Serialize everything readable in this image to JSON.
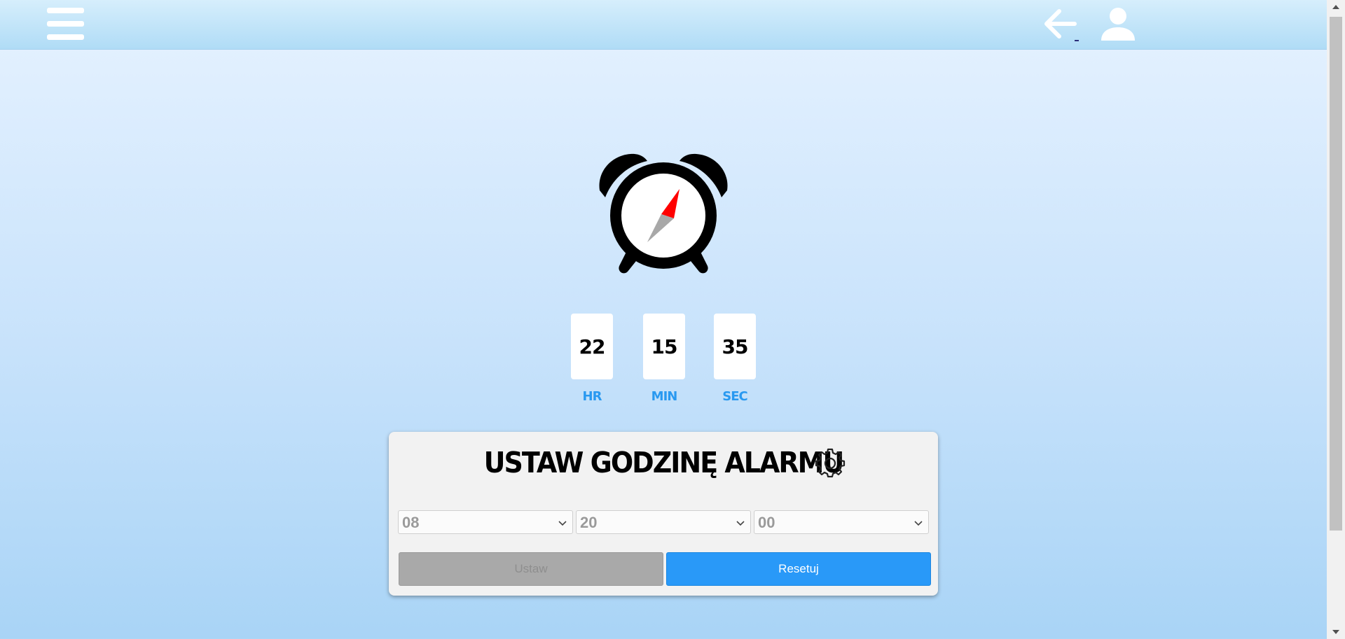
{
  "header": {
    "menu_icon": "hamburger-menu-icon",
    "back_icon": "arrow-left-icon",
    "user_icon": "user-icon"
  },
  "clock": {
    "icon": "alarm-clock-icon",
    "hours": "22",
    "minutes": "15",
    "seconds": "35",
    "hours_label": "HR",
    "minutes_label": "MIN",
    "seconds_label": "SEC"
  },
  "alarm_panel": {
    "title": "USTAW GODZINĘ ALARMU",
    "settings_icon": "gear-icon",
    "hour_select": "08",
    "minute_select": "20",
    "second_select": "00",
    "set_button": "Ustaw",
    "reset_button": "Resetuj"
  },
  "colors": {
    "accent": "#2999f8",
    "label_blue": "#2999f0",
    "needle_red": "#ff0000",
    "needle_gray": "#a8a8a8",
    "disabled_button": "#a9a9a9"
  }
}
